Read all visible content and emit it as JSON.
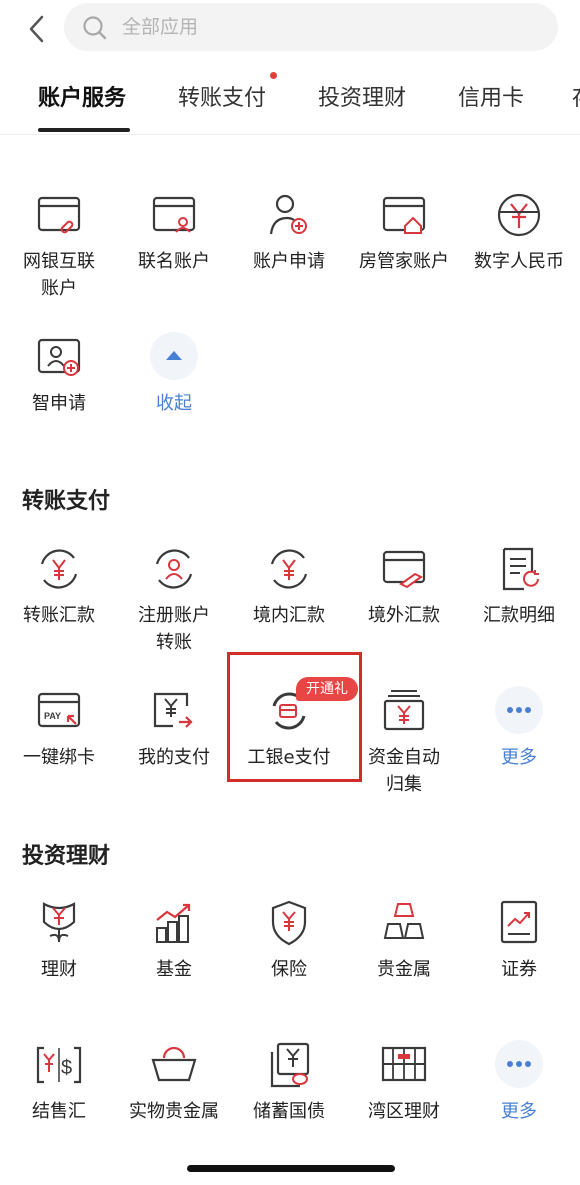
{
  "search": {
    "placeholder": "全部应用"
  },
  "tabs": [
    {
      "label": "账户服务",
      "active": true
    },
    {
      "label": "转账支付",
      "badge_dot": true
    },
    {
      "label": "投资理财"
    },
    {
      "label": "信用卡"
    },
    {
      "label": "存"
    }
  ],
  "account_services": {
    "items": [
      {
        "label": "网银互联\n账户",
        "icon": "bank-link-card-icon"
      },
      {
        "label": "联名账户",
        "icon": "joint-account-card-icon"
      },
      {
        "label": "账户申请",
        "icon": "person-add-icon"
      },
      {
        "label": "房管家账户",
        "icon": "house-card-icon"
      },
      {
        "label": "数字人民币",
        "icon": "digital-rmb-icon"
      },
      {
        "label": "智申请",
        "icon": "smart-apply-icon"
      },
      {
        "label": "收起",
        "icon": "collapse-up-icon"
      }
    ]
  },
  "transfer": {
    "title": "转账支付",
    "items": [
      {
        "label": "转账汇款",
        "icon": "transfer-yuan-icon"
      },
      {
        "label": "注册账户\n转账",
        "icon": "registered-transfer-icon"
      },
      {
        "label": "境内汇款",
        "icon": "domestic-remit-icon"
      },
      {
        "label": "境外汇款",
        "icon": "overseas-remit-icon"
      },
      {
        "label": "汇款明细",
        "icon": "remit-detail-icon"
      },
      {
        "label": "一键绑卡",
        "icon": "pay-card-bind-icon"
      },
      {
        "label": "我的支付",
        "icon": "my-payment-icon"
      },
      {
        "label": "工银e支付",
        "icon": "icbc-epay-icon",
        "tag": "开通礼"
      },
      {
        "label": "资金自动\n归集",
        "icon": "fund-collect-icon"
      },
      {
        "label": "更多",
        "icon": "more-dots-icon"
      }
    ]
  },
  "invest": {
    "title": "投资理财",
    "items": [
      {
        "label": "理财",
        "icon": "wealth-flower-icon"
      },
      {
        "label": "基金",
        "icon": "fund-chart-icon"
      },
      {
        "label": "保险",
        "icon": "insurance-shield-icon"
      },
      {
        "label": "贵金属",
        "icon": "gold-bars-icon"
      },
      {
        "label": "证券",
        "icon": "securities-icon"
      },
      {
        "label": "结售汇",
        "icon": "fx-exchange-icon"
      },
      {
        "label": "实物贵金属",
        "icon": "physical-gold-icon"
      },
      {
        "label": "储蓄国债",
        "icon": "savings-bond-icon"
      },
      {
        "label": "湾区理财",
        "icon": "bay-area-wealth-icon"
      },
      {
        "label": "更多",
        "icon": "more-dots-icon"
      }
    ]
  },
  "colors": {
    "accent_red": "#d9363e",
    "link_blue": "#4a7fd4",
    "icon_gray": "#3a3a3a"
  }
}
